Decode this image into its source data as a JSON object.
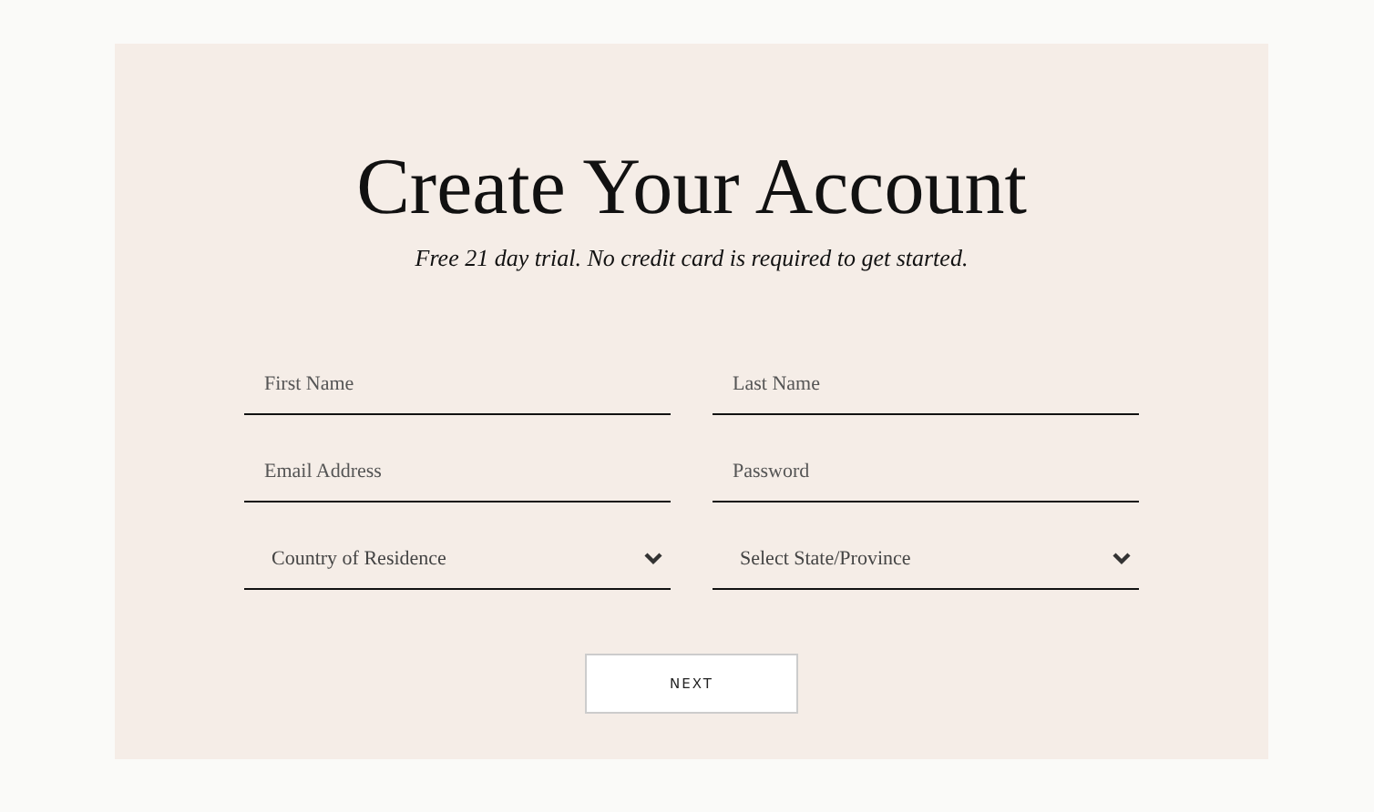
{
  "title": "Create Your Account",
  "subtitle": "Free 21 day trial. No credit card is required to get started.",
  "fields": [
    {
      "kind": "text",
      "placeholder": "First Name"
    },
    {
      "kind": "text",
      "placeholder": "Last Name"
    },
    {
      "kind": "text",
      "placeholder": "Email Address"
    },
    {
      "kind": "password",
      "placeholder": "Password"
    },
    {
      "kind": "select",
      "value": "Country of Residence"
    },
    {
      "kind": "select",
      "value": "Select State/Province"
    }
  ],
  "button": "NEXT"
}
